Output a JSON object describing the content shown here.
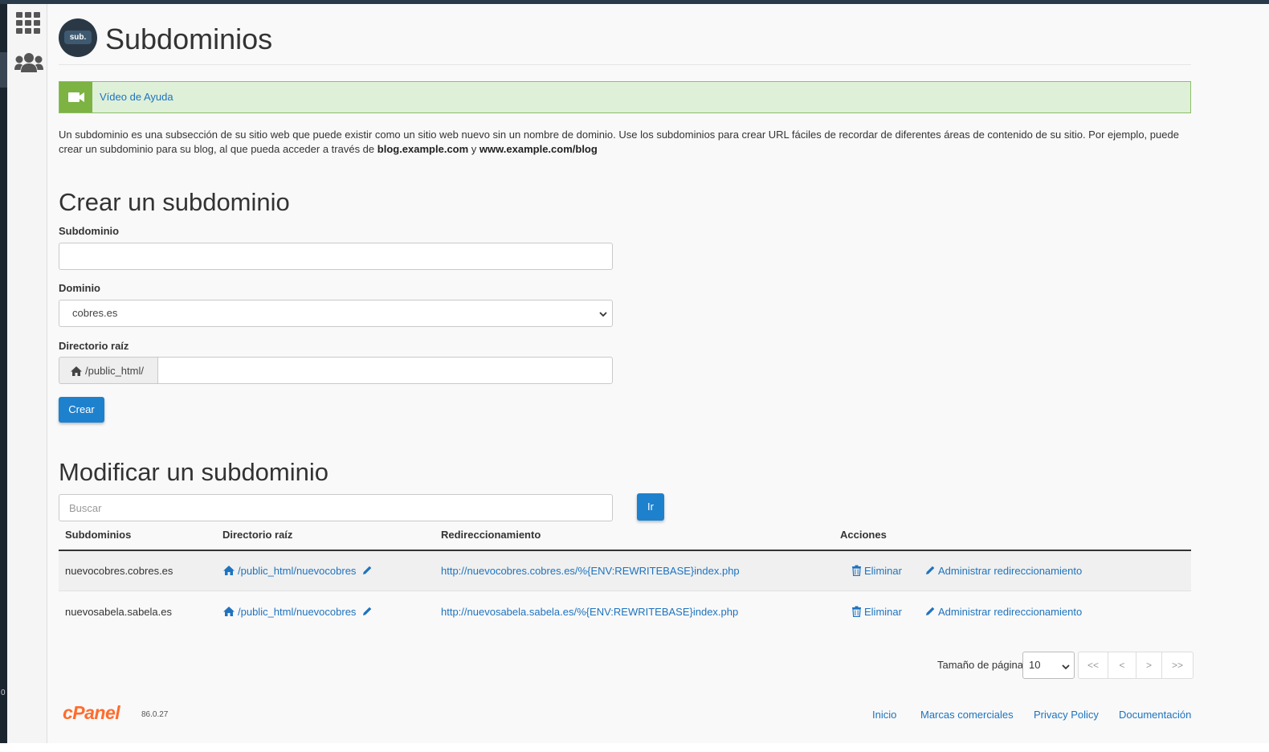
{
  "app": {
    "title": "Subdominios",
    "logo_text": "sub.",
    "help_video_label": "Vídeo de Ayuda"
  },
  "intro": {
    "text_before": "Un subdominio es una subsección de su sitio web que puede existir como un sitio web nuevo sin un nombre de dominio. Use los subdominios para crear URL fáciles de recordar de diferentes áreas de contenido de su sitio. Por ejemplo, puede crear un subdominio para su blog, al que pueda acceder a través de ",
    "example_1": "blog.example.com",
    "connector": " y ",
    "example_2": "www.example.com/blog"
  },
  "create_section": {
    "heading": "Crear un subdominio",
    "subdomain_label": "Subdominio",
    "subdomain_value": "",
    "domain_label": "Dominio",
    "domain_selected": "cobres.es",
    "docroot_label": "Directorio raíz",
    "docroot_prefix": "/public_html/",
    "docroot_value": "",
    "create_button": "Crear"
  },
  "modify_section": {
    "heading": "Modificar un subdominio",
    "search_placeholder": "Buscar",
    "go_button": "Ir",
    "columns": [
      "Subdominios",
      "Directorio raíz",
      "Redireccionamiento",
      "Acciones"
    ],
    "rows": [
      {
        "subdomain": "nuevocobres.cobres.es",
        "docroot": "/public_html/nuevocobres",
        "redirect": "http://nuevocobres.cobres.es/%{ENV:REWRITEBASE}index.php",
        "delete_label": "Eliminar",
        "manage_label": "Administrar redireccionamiento"
      },
      {
        "subdomain": "nuevosabela.sabela.es",
        "docroot": "/public_html/nuevocobres",
        "redirect": "http://nuevosabela.sabela.es/%{ENV:REWRITEBASE}index.php",
        "delete_label": "Eliminar",
        "manage_label": "Administrar redireccionamiento"
      }
    ]
  },
  "pagination": {
    "page_size_label": "Tamaño de página",
    "page_size": "10",
    "first": "<<",
    "prev": "<",
    "next": ">",
    "last": ">>"
  },
  "footer": {
    "logo_text": "cPanel",
    "version": "86.0.27",
    "links": [
      "Inicio",
      "Marcas comerciales",
      "Privacy Policy",
      "Documentación"
    ]
  },
  "misc": {
    "edge_digit": "0"
  },
  "colors": {
    "primary_button": "#1e81ce",
    "link": "#1e73be",
    "help_box_bg": "#dff0d8",
    "help_icon": "#7cb342",
    "cpanel_orange": "#ff6c2c"
  },
  "icons": [
    "grid-icon",
    "users-icon",
    "video-camera-icon",
    "home-icon",
    "pencil-icon",
    "trash-icon",
    "chevron-down-icon"
  ]
}
